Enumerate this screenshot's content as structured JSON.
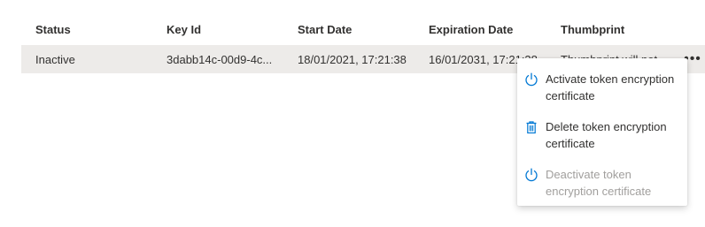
{
  "table": {
    "headers": {
      "status": "Status",
      "key_id": "Key Id",
      "start_date": "Start Date",
      "expiration_date": "Expiration Date",
      "thumbprint": "Thumbprint"
    },
    "rows": [
      {
        "status": "Inactive",
        "key_id": "3dabb14c-00d9-4c...",
        "start_date": "18/01/2021, 17:21:38",
        "expiration_date": "16/01/2031, 17:21:38",
        "thumbprint": "Thumbprint will not",
        "more_label": "•••"
      }
    ]
  },
  "context_menu": {
    "items": [
      {
        "label": "Activate token encryption certificate",
        "icon": "power-icon",
        "enabled": true
      },
      {
        "label": "Delete token encryption certificate",
        "icon": "trash-icon",
        "enabled": true
      },
      {
        "label": "Deactivate token encryption certificate",
        "icon": "power-icon",
        "enabled": false
      }
    ]
  },
  "colors": {
    "accent": "#0078d4",
    "row_selected_bg": "#edebe9",
    "disabled_text": "#a19f9d",
    "text": "#323130"
  }
}
